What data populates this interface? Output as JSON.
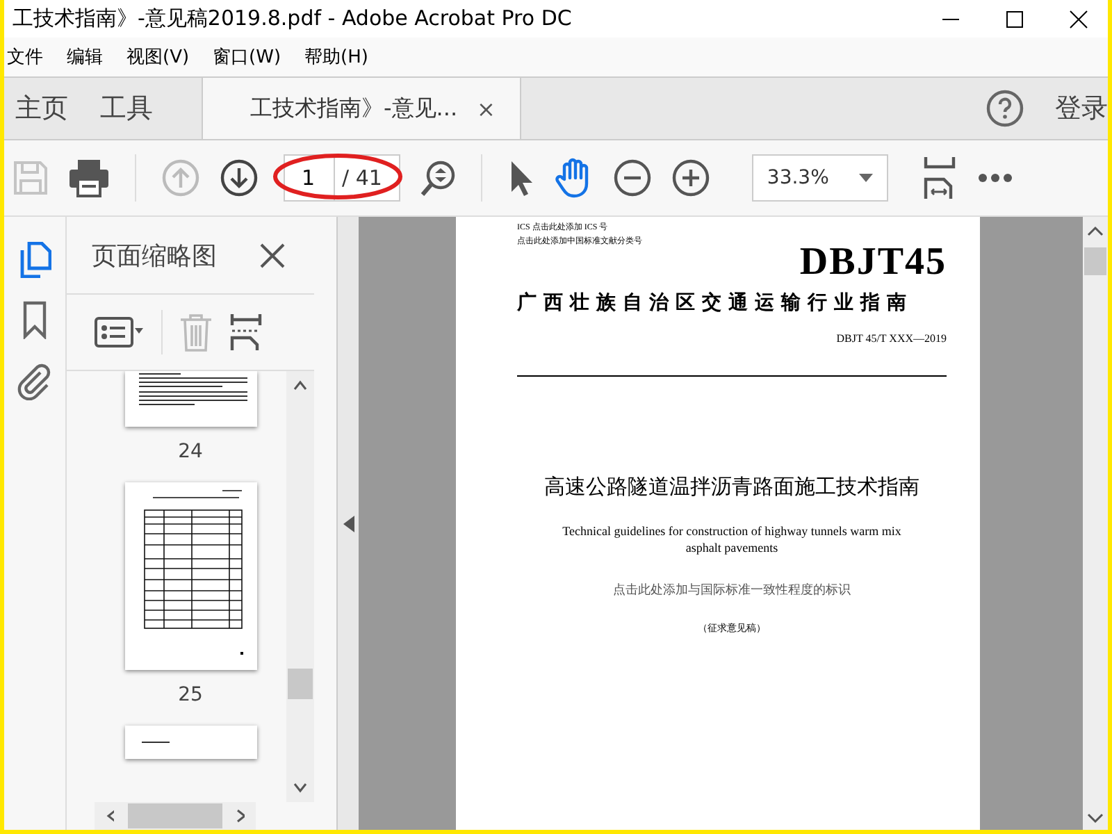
{
  "window": {
    "title": "工技术指南》-意见稿2019.8.pdf - Adobe Acrobat Pro DC"
  },
  "menu": [
    "文件",
    "编辑",
    "视图(V)",
    "窗口(W)",
    "帮助(H)"
  ],
  "tabs": [
    {
      "label": "主页",
      "kind": "nav",
      "selected": false
    },
    {
      "label": "工具",
      "kind": "nav",
      "selected": false
    },
    {
      "label": "工技术指南》-意见...",
      "kind": "doc",
      "selected": true,
      "close": "×"
    }
  ],
  "sign_in": "登录",
  "toolbar": {
    "page_value": "1",
    "page_total": "/ 41",
    "zoom": "33.3%",
    "highlighted": true
  },
  "rail": [
    {
      "kind": "pages",
      "selected": true
    },
    {
      "kind": "bookmark",
      "selected": false
    },
    {
      "kind": "attach",
      "selected": false
    }
  ],
  "panel": {
    "title": "页面缩略图",
    "thumbnails": [
      {
        "kind": "text",
        "page": "24"
      },
      {
        "kind": "table",
        "page": "25"
      },
      {
        "kind": "partial"
      }
    ]
  },
  "document": {
    "ics": "ICS 点击此处添加 ICS 号",
    "classification": "点击此处添加中国标准文献分类号",
    "code": "DBJT45",
    "org": "广西壮族自治区交通运输行业指南",
    "number": "DBJT 45/T XXX—2019",
    "title_cn": "高速公路隧道温拌沥青路面施工技术指南",
    "title_en": "Technical guidelines for construction of highway tunnels warm mix asphalt pavements",
    "consistency": "点击此处添加与国际标准一致性程度的标识",
    "draft": "（征求意见稿）"
  }
}
